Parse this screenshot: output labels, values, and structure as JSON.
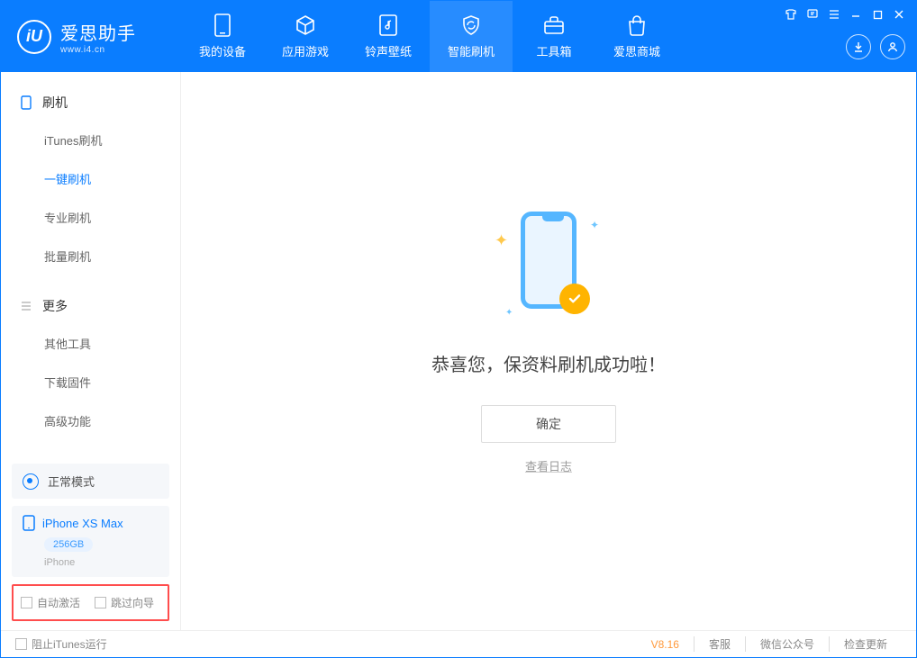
{
  "app": {
    "title": "爱思助手",
    "subtitle": "www.i4.cn"
  },
  "nav": [
    {
      "label": "我的设备"
    },
    {
      "label": "应用游戏"
    },
    {
      "label": "铃声壁纸"
    },
    {
      "label": "智能刷机"
    },
    {
      "label": "工具箱"
    },
    {
      "label": "爱思商城"
    }
  ],
  "sidebar": {
    "section1": {
      "title": "刷机",
      "items": [
        "iTunes刷机",
        "一键刷机",
        "专业刷机",
        "批量刷机"
      ]
    },
    "section2": {
      "title": "更多",
      "items": [
        "其他工具",
        "下载固件",
        "高级功能"
      ]
    },
    "mode": "正常模式",
    "device": {
      "name": "iPhone XS Max",
      "storage": "256GB",
      "type": "iPhone"
    },
    "checkbox1": "自动激活",
    "checkbox2": "跳过向导"
  },
  "result": {
    "message": "恭喜您，保资料刷机成功啦！",
    "confirm": "确定",
    "viewlog": "查看日志"
  },
  "footer": {
    "block_itunes": "阻止iTunes运行",
    "version": "V8.16",
    "links": [
      "客服",
      "微信公众号",
      "检查更新"
    ]
  }
}
